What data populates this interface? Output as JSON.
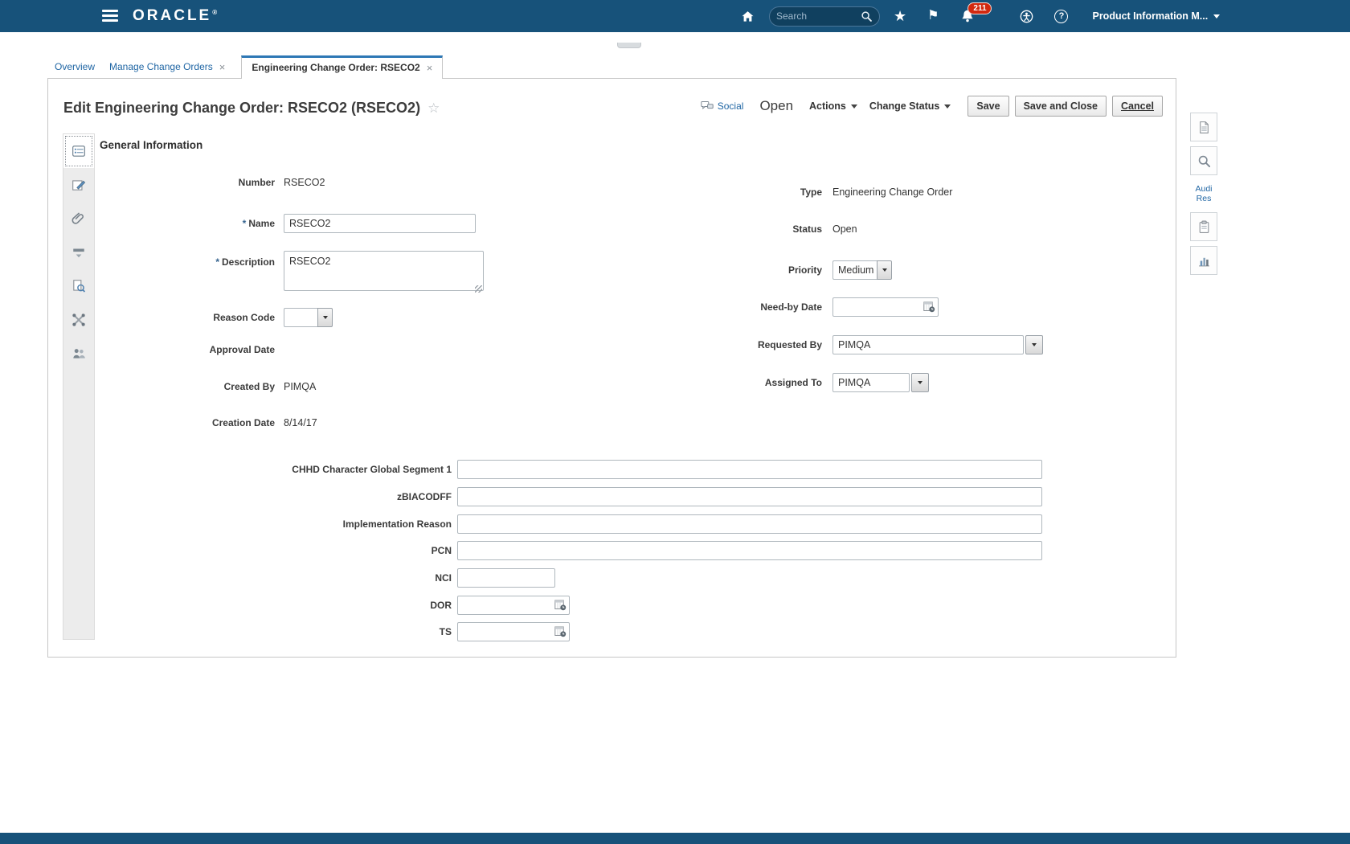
{
  "icons": {
    "close": "×",
    "star": "★",
    "flag": "⚑",
    "fav_star": "☆",
    "help": "?",
    "required": "*"
  },
  "topbar": {
    "brand": "ORACLE",
    "brand_mark": "®",
    "search": {
      "placeholder": "Search"
    },
    "notification_count": "211",
    "user_menu_label": "Product Information M..."
  },
  "tabs": {
    "overview": "Overview",
    "manage_change_orders": "Manage Change Orders",
    "engineering_change_order": "Engineering Change Order: RSECO2"
  },
  "header": {
    "title": "Edit Engineering Change Order: RSECO2 (RSECO2)",
    "social": "Social",
    "status": "Open",
    "actions": "Actions",
    "change_status": "Change Status",
    "save": "Save",
    "save_and_close": "Save and Close",
    "cancel": "Cancel"
  },
  "section_title": "General Information",
  "form": {
    "number": {
      "label": "Number",
      "value": "RSECO2"
    },
    "name": {
      "label": "Name",
      "value": "RSECO2"
    },
    "description": {
      "label": "Description",
      "value": "RSECO2"
    },
    "reason_code": {
      "label": "Reason Code",
      "value": ""
    },
    "approval_date": {
      "label": "Approval Date",
      "value": ""
    },
    "created_by": {
      "label": "Created By",
      "value": "PIMQA"
    },
    "creation_date": {
      "label": "Creation Date",
      "value": "8/14/17"
    },
    "type": {
      "label": "Type",
      "value": "Engineering Change Order"
    },
    "status": {
      "label": "Status",
      "value": "Open"
    },
    "priority": {
      "label": "Priority",
      "value": "Medium"
    },
    "need_by_date": {
      "label": "Need-by Date",
      "value": ""
    },
    "requested_by": {
      "label": "Requested By",
      "value": "PIMQA"
    },
    "assigned_to": {
      "label": "Assigned To",
      "value": "PIMQA"
    },
    "chhd": {
      "label": "CHHD Character Global Segment 1",
      "value": ""
    },
    "zbiacodff": {
      "label": "zBIACODFF",
      "value": ""
    },
    "implementation_reason": {
      "label": "Implementation Reason",
      "value": ""
    },
    "pcn": {
      "label": "PCN",
      "value": ""
    },
    "nci": {
      "label": "NCI",
      "value": ""
    },
    "dor": {
      "label": "DOR",
      "value": ""
    },
    "ts": {
      "label": "TS",
      "value": ""
    }
  },
  "right_rail": {
    "audit_label": "Audi Res"
  }
}
